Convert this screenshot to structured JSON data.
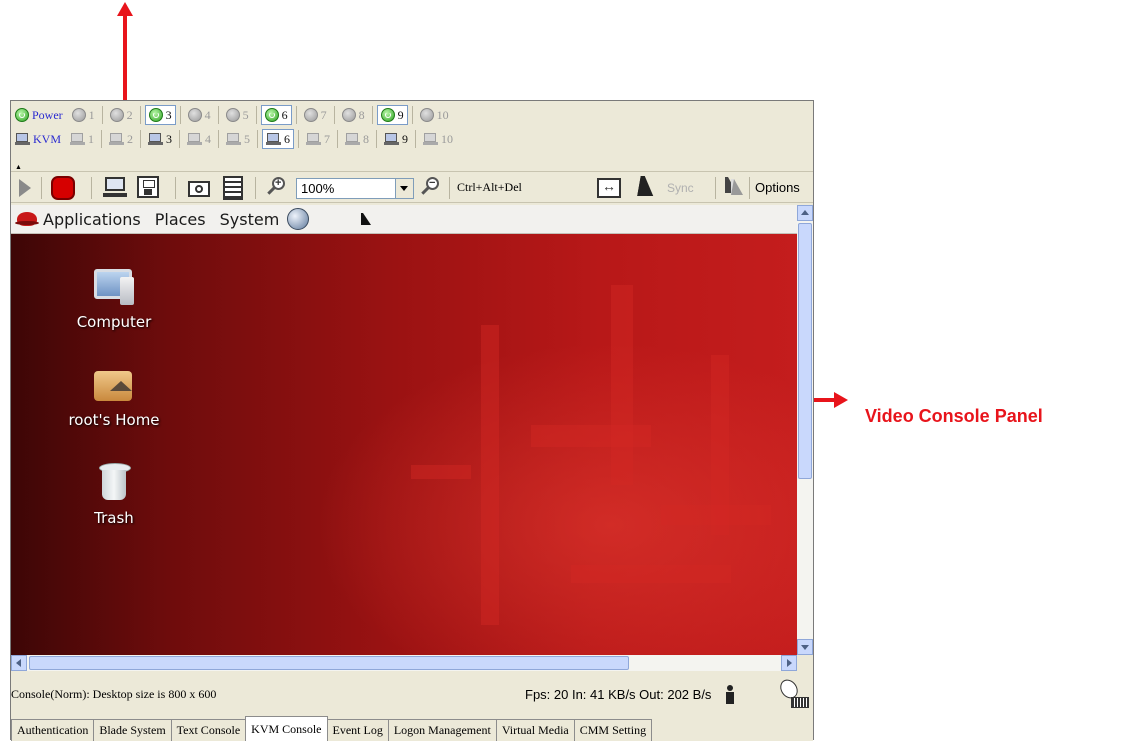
{
  "annotation": {
    "label": "Video Console Panel"
  },
  "blade_panel": {
    "power_label": "Power",
    "kvm_label": "KVM",
    "slots": [
      "1",
      "2",
      "3",
      "4",
      "5",
      "6",
      "7",
      "8",
      "9",
      "10"
    ],
    "active_slots": [
      "3",
      "6",
      "9"
    ]
  },
  "toolbar": {
    "zoom_value": "100%",
    "ctrl_alt_del": "Ctrl+Alt+Del",
    "sync_label": "Sync",
    "options_label": "Options"
  },
  "desktop": {
    "menus": [
      "Applications",
      "Places",
      "System"
    ],
    "icons": [
      "Computer",
      "root's Home",
      "Trash"
    ]
  },
  "status": {
    "left": "Console(Norm): Desktop size is 800 x 600",
    "right": "Fps: 20 In: 41 KB/s Out: 202 B/s"
  },
  "tabs": [
    "Authentication",
    "Blade System",
    "Text Console",
    "KVM Console",
    "Event Log",
    "Logon Management",
    "Virtual Media",
    "CMM Setting"
  ],
  "selected_tab": "KVM Console"
}
